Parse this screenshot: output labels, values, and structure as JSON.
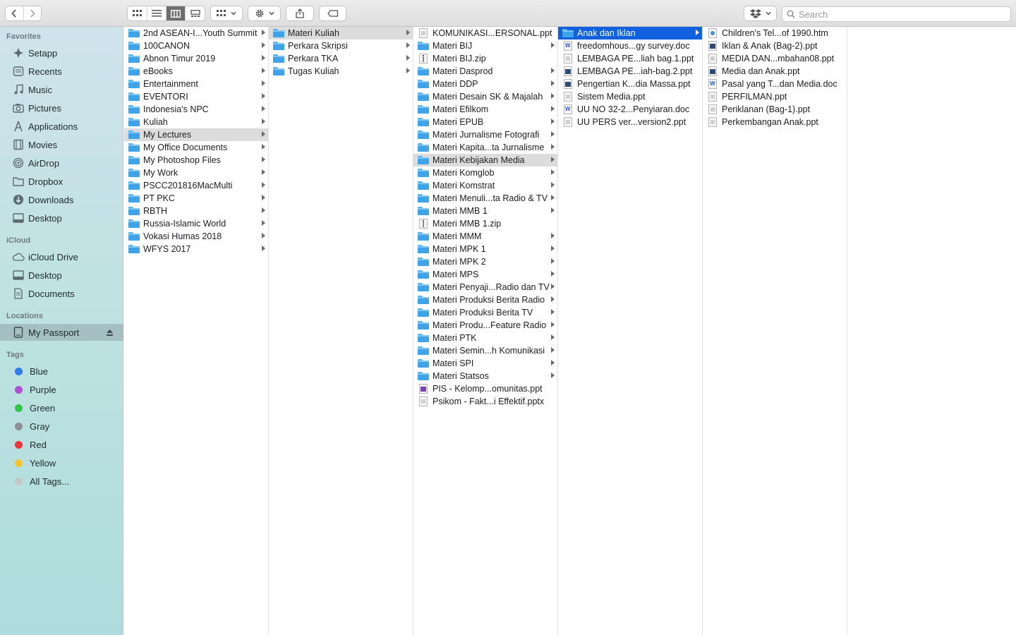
{
  "toolbar": {
    "search_placeholder": "Search"
  },
  "sidebar": {
    "favorites_header": "Favorites",
    "favorites": [
      {
        "label": "Setapp",
        "icon": "setapp-icon"
      },
      {
        "label": "Recents",
        "icon": "clock-icon"
      },
      {
        "label": "Music",
        "icon": "music-note-icon"
      },
      {
        "label": "Pictures",
        "icon": "camera-icon"
      },
      {
        "label": "Applications",
        "icon": "applications-icon"
      },
      {
        "label": "Movies",
        "icon": "film-icon"
      },
      {
        "label": "AirDrop",
        "icon": "airdrop-icon"
      },
      {
        "label": "Dropbox",
        "icon": "folder-icon"
      },
      {
        "label": "Downloads",
        "icon": "download-icon"
      },
      {
        "label": "Desktop",
        "icon": "desktop-icon"
      }
    ],
    "icloud_header": "iCloud",
    "icloud": [
      {
        "label": "iCloud Drive",
        "icon": "cloud-icon"
      },
      {
        "label": "Desktop",
        "icon": "desktop-icon"
      },
      {
        "label": "Documents",
        "icon": "document-icon"
      }
    ],
    "locations_header": "Locations",
    "locations": [
      {
        "label": "My Passport",
        "icon": "drive-icon"
      }
    ],
    "tags_header": "Tags",
    "tags": [
      {
        "label": "Blue",
        "color": "#2e7cf6"
      },
      {
        "label": "Purple",
        "color": "#b04fd6"
      },
      {
        "label": "Green",
        "color": "#33c748"
      },
      {
        "label": "Gray",
        "color": "#8e8e93"
      },
      {
        "label": "Red",
        "color": "#f2353a"
      },
      {
        "label": "Yellow",
        "color": "#f7c52b"
      },
      {
        "label": "All Tags...",
        "color": "#c7c7c7"
      }
    ]
  },
  "columns": {
    "col1": [
      {
        "name": "2nd ASEAN-I...Youth Summit",
        "type": "folder"
      },
      {
        "name": "100CANON",
        "type": "folder"
      },
      {
        "name": "Abnon Timur 2019",
        "type": "folder"
      },
      {
        "name": "eBooks",
        "type": "folder"
      },
      {
        "name": "Entertainment",
        "type": "folder"
      },
      {
        "name": "EVENTORI",
        "type": "folder"
      },
      {
        "name": "Indonesia's NPC",
        "type": "folder"
      },
      {
        "name": "Kuliah",
        "type": "folder"
      },
      {
        "name": "My Lectures",
        "type": "folder",
        "selected": "gray"
      },
      {
        "name": "My Office Documents",
        "type": "folder"
      },
      {
        "name": "My Photoshop Files",
        "type": "folder"
      },
      {
        "name": "My Work",
        "type": "folder"
      },
      {
        "name": "PSCC201816MacMulti",
        "type": "folder"
      },
      {
        "name": "PT PKC",
        "type": "folder"
      },
      {
        "name": "RBTH",
        "type": "folder"
      },
      {
        "name": "Russia-Islamic World",
        "type": "folder"
      },
      {
        "name": "Vokasi Humas 2018",
        "type": "folder"
      },
      {
        "name": "WFYS 2017",
        "type": "folder"
      }
    ],
    "col2": [
      {
        "name": "Materi Kuliah",
        "type": "folder",
        "selected": "gray"
      },
      {
        "name": "Perkara Skripsi",
        "type": "folder"
      },
      {
        "name": "Perkara TKA",
        "type": "folder"
      },
      {
        "name": "Tugas Kuliah",
        "type": "folder"
      }
    ],
    "col3": [
      {
        "name": "KOMUNIKASI...ERSONAL.ppt",
        "type": "ppt"
      },
      {
        "name": "Materi BIJ",
        "type": "folder"
      },
      {
        "name": "Materi BIJ.zip",
        "type": "zip"
      },
      {
        "name": "Materi Dasprod",
        "type": "folder"
      },
      {
        "name": "Materi DDP",
        "type": "folder"
      },
      {
        "name": "Materi Desain SK & Majalah",
        "type": "folder"
      },
      {
        "name": "Materi Efilkom",
        "type": "folder"
      },
      {
        "name": "Materi EPUB",
        "type": "folder"
      },
      {
        "name": "Materi Jurnalisme Fotografi",
        "type": "folder"
      },
      {
        "name": "Materi Kapita...ta Jurnalisme",
        "type": "folder"
      },
      {
        "name": "Materi Kebijakan Media",
        "type": "folder",
        "selected": "gray"
      },
      {
        "name": "Materi Komglob",
        "type": "folder"
      },
      {
        "name": "Materi Komstrat",
        "type": "folder"
      },
      {
        "name": "Materi Menuli...ta Radio & TV",
        "type": "folder"
      },
      {
        "name": "Materi MMB 1",
        "type": "folder"
      },
      {
        "name": "Materi MMB 1.zip",
        "type": "zip"
      },
      {
        "name": "Materi MMM",
        "type": "folder"
      },
      {
        "name": "Materi MPK 1",
        "type": "folder"
      },
      {
        "name": "Materi MPK 2",
        "type": "folder"
      },
      {
        "name": "Materi MPS",
        "type": "folder"
      },
      {
        "name": "Materi Penyaji...Radio dan TV",
        "type": "folder"
      },
      {
        "name": "Materi Produksi Berita Radio",
        "type": "folder"
      },
      {
        "name": "Materi Produksi Berita TV",
        "type": "folder"
      },
      {
        "name": "Materi Produ...Feature Radio",
        "type": "folder"
      },
      {
        "name": "Materi PTK",
        "type": "folder"
      },
      {
        "name": "Materi Semin...h Komunikasi",
        "type": "folder"
      },
      {
        "name": "Materi SPI",
        "type": "folder"
      },
      {
        "name": "Materi Statsos",
        "type": "folder"
      },
      {
        "name": "PIS - Kelomp...omunitas.ppt",
        "type": "purple"
      },
      {
        "name": "Psikom - Fakt...i Effektif.pptx",
        "type": "ppt"
      }
    ],
    "col4": [
      {
        "name": "Anak dan Iklan",
        "type": "folder",
        "selected": "blue"
      },
      {
        "name": "freedomhous...gy survey.doc",
        "type": "word"
      },
      {
        "name": "LEMBAGA PE...liah bag.1.ppt",
        "type": "ppt"
      },
      {
        "name": "LEMBAGA PE...iah-bag.2.ppt",
        "type": "dark"
      },
      {
        "name": "Pengertian K...dia Massa.ppt",
        "type": "dark"
      },
      {
        "name": "Sistem Media.ppt",
        "type": "ppt"
      },
      {
        "name": "UU NO 32-2...Penyiaran.doc",
        "type": "word"
      },
      {
        "name": "UU PERS ver...version2.ppt",
        "type": "ppt"
      }
    ],
    "col5": [
      {
        "name": "Children's Tel...of 1990.htm",
        "type": "web"
      },
      {
        "name": "Iklan & Anak (Bag-2).ppt",
        "type": "dark"
      },
      {
        "name": "MEDIA DAN...mbahan08.ppt",
        "type": "ppt"
      },
      {
        "name": "Media dan Anak.ppt",
        "type": "dark"
      },
      {
        "name": "Pasal yang T...dan Media.doc",
        "type": "word"
      },
      {
        "name": "PERFILMAN.ppt",
        "type": "ppt"
      },
      {
        "name": "Periklanan (Bag-1).ppt",
        "type": "ppt"
      },
      {
        "name": "Perkembangan  Anak.ppt",
        "type": "ppt"
      }
    ]
  }
}
